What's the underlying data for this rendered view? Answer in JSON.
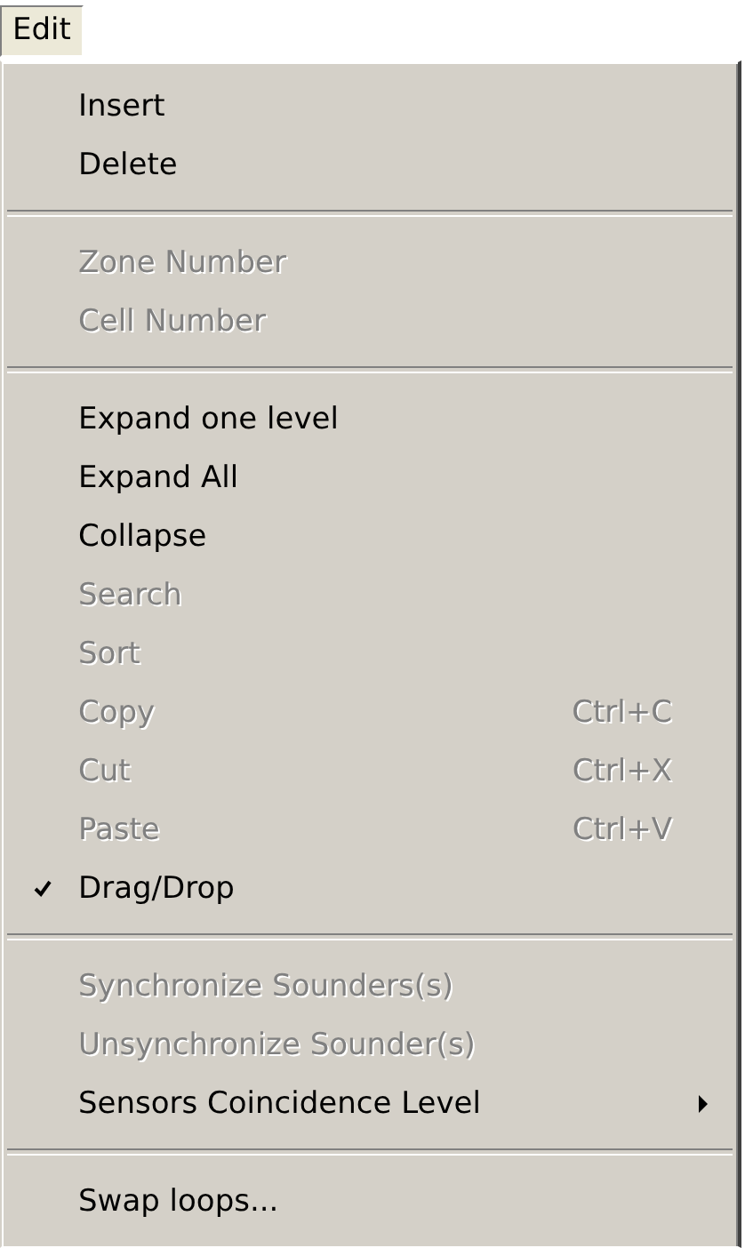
{
  "menu_bar": [
    {
      "label": "Edit",
      "selected": true
    }
  ],
  "menu": {
    "items": [
      {
        "kind": "item",
        "label": "Insert",
        "disabled": false
      },
      {
        "kind": "item",
        "label": "Delete",
        "disabled": false
      },
      {
        "kind": "separator"
      },
      {
        "kind": "item",
        "label": "Zone Number",
        "disabled": true
      },
      {
        "kind": "item",
        "label": "Cell Number",
        "disabled": true
      },
      {
        "kind": "separator"
      },
      {
        "kind": "item",
        "label": "Expand one level",
        "disabled": false
      },
      {
        "kind": "item",
        "label": "Expand All",
        "disabled": false
      },
      {
        "kind": "item",
        "label": "Collapse",
        "disabled": false
      },
      {
        "kind": "item",
        "label": "Search",
        "disabled": true
      },
      {
        "kind": "item",
        "label": "Sort",
        "disabled": true
      },
      {
        "kind": "item",
        "label": "Copy",
        "disabled": true,
        "shortcut": "Ctrl+C"
      },
      {
        "kind": "item",
        "label": "Cut",
        "disabled": true,
        "shortcut": "Ctrl+X"
      },
      {
        "kind": "item",
        "label": "Paste",
        "disabled": true,
        "shortcut": "Ctrl+V"
      },
      {
        "kind": "item",
        "label": "Drag/Drop",
        "disabled": false,
        "checked": true
      },
      {
        "kind": "separator"
      },
      {
        "kind": "item",
        "label": "Synchronize Sounders(s)",
        "disabled": true
      },
      {
        "kind": "item",
        "label": "Unsynchronize Sounder(s)",
        "disabled": true
      },
      {
        "kind": "item",
        "label": "Sensors Coincidence Level",
        "disabled": false,
        "submenu": true
      },
      {
        "kind": "separator"
      },
      {
        "kind": "item",
        "label": "Swap loops...",
        "disabled": false
      }
    ]
  }
}
